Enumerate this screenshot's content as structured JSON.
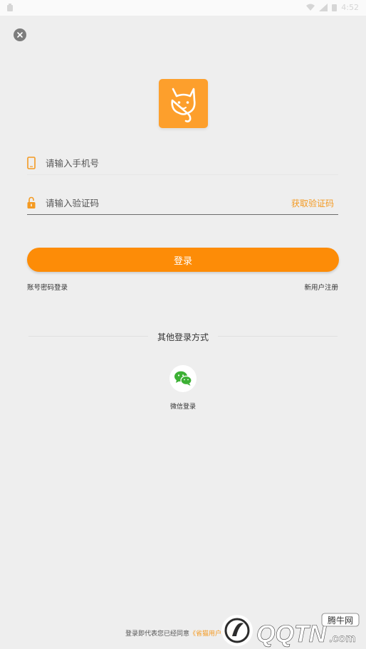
{
  "status_bar": {
    "time": "4:52"
  },
  "icons": {
    "close": "close-icon",
    "logo": "cat-logo-icon",
    "phone": "phone-icon",
    "lock": "lock-icon",
    "wechat": "wechat-icon"
  },
  "form": {
    "phone_placeholder": "请输入手机号",
    "code_placeholder": "请输入验证码",
    "get_code_label": "获取验证码",
    "login_label": "登录",
    "account_login_label": "账号密码登录",
    "register_label": "新用户注册"
  },
  "other_login": {
    "title": "其他登录方式",
    "wechat_label": "微信登录"
  },
  "agreement": {
    "prefix": "登录即代表您已经同意",
    "link": "《省猫用户协议》"
  },
  "watermark": {
    "brand": "QQTN.com",
    "tag": "腾牛网"
  },
  "colors": {
    "accent": "#fd8c07",
    "accent_text": "#f49a22",
    "background": "#eeeeee"
  }
}
